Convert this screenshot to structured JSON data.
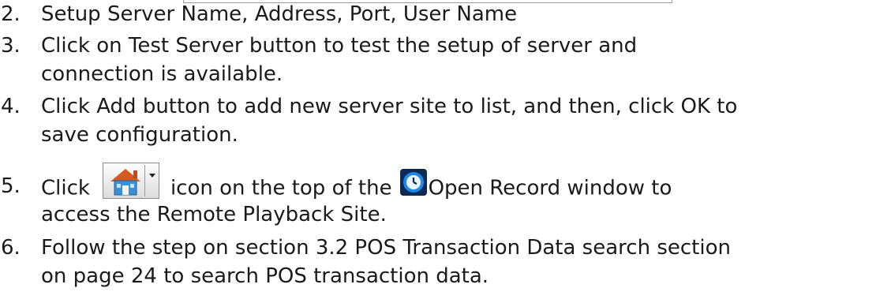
{
  "steps": [
    {
      "number": "2.",
      "lines": [
        "Setup Server Name, Address, Port, User Name"
      ]
    },
    {
      "number": "3.",
      "lines": [
        "Click on Test Server button to test the setup of server and",
        "connection is available."
      ]
    },
    {
      "number": "4.",
      "lines": [
        "Click Add button to add new server site to list, and then, click OK to",
        "save configuration."
      ]
    },
    {
      "number": "5.",
      "line1_before_icon": "Click",
      "line1_middle": "icon on the top of the",
      "line1_after_icon": "Open Record window to",
      "line2": "access the Remote Playback Site.",
      "icons": [
        "home-dropdown-icon",
        "open-record-clock-icon"
      ]
    },
    {
      "number": "6.",
      "lines": [
        "Follow the step on section 3.2 POS Transaction Data search section",
        "on page 24 to search POS transaction data."
      ]
    }
  ],
  "colors": {
    "text": "#1a1a1a",
    "clock_blue": "#1e88e5",
    "clock_ring": "#0b2a55",
    "house_blue": "#3b8fd6",
    "house_roof": "#d85a1e"
  }
}
